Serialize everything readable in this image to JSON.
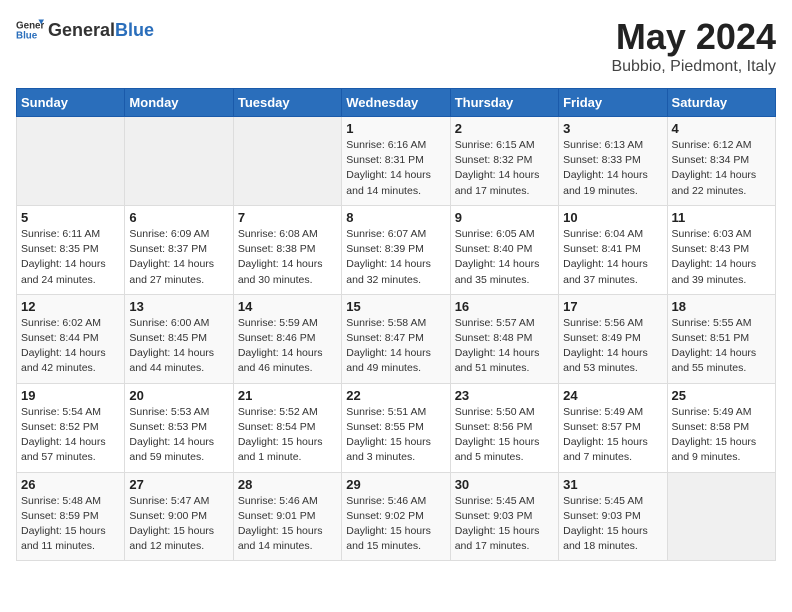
{
  "header": {
    "logo_general": "General",
    "logo_blue": "Blue",
    "title": "May 2024",
    "subtitle": "Bubbio, Piedmont, Italy"
  },
  "calendar": {
    "days_of_week": [
      "Sunday",
      "Monday",
      "Tuesday",
      "Wednesday",
      "Thursday",
      "Friday",
      "Saturday"
    ],
    "weeks": [
      [
        {
          "day": "",
          "info": ""
        },
        {
          "day": "",
          "info": ""
        },
        {
          "day": "",
          "info": ""
        },
        {
          "day": "1",
          "info": "Sunrise: 6:16 AM\nSunset: 8:31 PM\nDaylight: 14 hours\nand 14 minutes."
        },
        {
          "day": "2",
          "info": "Sunrise: 6:15 AM\nSunset: 8:32 PM\nDaylight: 14 hours\nand 17 minutes."
        },
        {
          "day": "3",
          "info": "Sunrise: 6:13 AM\nSunset: 8:33 PM\nDaylight: 14 hours\nand 19 minutes."
        },
        {
          "day": "4",
          "info": "Sunrise: 6:12 AM\nSunset: 8:34 PM\nDaylight: 14 hours\nand 22 minutes."
        }
      ],
      [
        {
          "day": "5",
          "info": "Sunrise: 6:11 AM\nSunset: 8:35 PM\nDaylight: 14 hours\nand 24 minutes."
        },
        {
          "day": "6",
          "info": "Sunrise: 6:09 AM\nSunset: 8:37 PM\nDaylight: 14 hours\nand 27 minutes."
        },
        {
          "day": "7",
          "info": "Sunrise: 6:08 AM\nSunset: 8:38 PM\nDaylight: 14 hours\nand 30 minutes."
        },
        {
          "day": "8",
          "info": "Sunrise: 6:07 AM\nSunset: 8:39 PM\nDaylight: 14 hours\nand 32 minutes."
        },
        {
          "day": "9",
          "info": "Sunrise: 6:05 AM\nSunset: 8:40 PM\nDaylight: 14 hours\nand 35 minutes."
        },
        {
          "day": "10",
          "info": "Sunrise: 6:04 AM\nSunset: 8:41 PM\nDaylight: 14 hours\nand 37 minutes."
        },
        {
          "day": "11",
          "info": "Sunrise: 6:03 AM\nSunset: 8:43 PM\nDaylight: 14 hours\nand 39 minutes."
        }
      ],
      [
        {
          "day": "12",
          "info": "Sunrise: 6:02 AM\nSunset: 8:44 PM\nDaylight: 14 hours\nand 42 minutes."
        },
        {
          "day": "13",
          "info": "Sunrise: 6:00 AM\nSunset: 8:45 PM\nDaylight: 14 hours\nand 44 minutes."
        },
        {
          "day": "14",
          "info": "Sunrise: 5:59 AM\nSunset: 8:46 PM\nDaylight: 14 hours\nand 46 minutes."
        },
        {
          "day": "15",
          "info": "Sunrise: 5:58 AM\nSunset: 8:47 PM\nDaylight: 14 hours\nand 49 minutes."
        },
        {
          "day": "16",
          "info": "Sunrise: 5:57 AM\nSunset: 8:48 PM\nDaylight: 14 hours\nand 51 minutes."
        },
        {
          "day": "17",
          "info": "Sunrise: 5:56 AM\nSunset: 8:49 PM\nDaylight: 14 hours\nand 53 minutes."
        },
        {
          "day": "18",
          "info": "Sunrise: 5:55 AM\nSunset: 8:51 PM\nDaylight: 14 hours\nand 55 minutes."
        }
      ],
      [
        {
          "day": "19",
          "info": "Sunrise: 5:54 AM\nSunset: 8:52 PM\nDaylight: 14 hours\nand 57 minutes."
        },
        {
          "day": "20",
          "info": "Sunrise: 5:53 AM\nSunset: 8:53 PM\nDaylight: 14 hours\nand 59 minutes."
        },
        {
          "day": "21",
          "info": "Sunrise: 5:52 AM\nSunset: 8:54 PM\nDaylight: 15 hours\nand 1 minute."
        },
        {
          "day": "22",
          "info": "Sunrise: 5:51 AM\nSunset: 8:55 PM\nDaylight: 15 hours\nand 3 minutes."
        },
        {
          "day": "23",
          "info": "Sunrise: 5:50 AM\nSunset: 8:56 PM\nDaylight: 15 hours\nand 5 minutes."
        },
        {
          "day": "24",
          "info": "Sunrise: 5:49 AM\nSunset: 8:57 PM\nDaylight: 15 hours\nand 7 minutes."
        },
        {
          "day": "25",
          "info": "Sunrise: 5:49 AM\nSunset: 8:58 PM\nDaylight: 15 hours\nand 9 minutes."
        }
      ],
      [
        {
          "day": "26",
          "info": "Sunrise: 5:48 AM\nSunset: 8:59 PM\nDaylight: 15 hours\nand 11 minutes."
        },
        {
          "day": "27",
          "info": "Sunrise: 5:47 AM\nSunset: 9:00 PM\nDaylight: 15 hours\nand 12 minutes."
        },
        {
          "day": "28",
          "info": "Sunrise: 5:46 AM\nSunset: 9:01 PM\nDaylight: 15 hours\nand 14 minutes."
        },
        {
          "day": "29",
          "info": "Sunrise: 5:46 AM\nSunset: 9:02 PM\nDaylight: 15 hours\nand 15 minutes."
        },
        {
          "day": "30",
          "info": "Sunrise: 5:45 AM\nSunset: 9:03 PM\nDaylight: 15 hours\nand 17 minutes."
        },
        {
          "day": "31",
          "info": "Sunrise: 5:45 AM\nSunset: 9:03 PM\nDaylight: 15 hours\nand 18 minutes."
        },
        {
          "day": "",
          "info": ""
        }
      ]
    ]
  }
}
